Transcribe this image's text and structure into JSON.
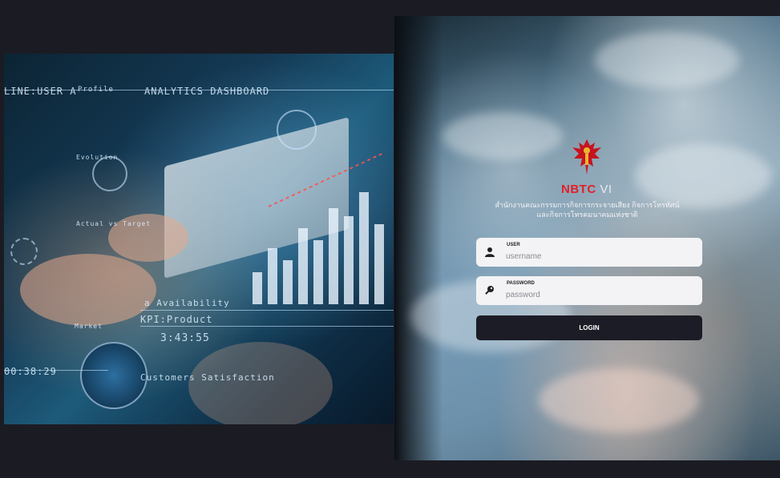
{
  "hero": {
    "texts": {
      "line_user": "LINE:USER A",
      "profile": "Profile",
      "dashboard": "ANALYTICS DASHBOARD",
      "evolution": "Evolution",
      "actual_vs_target": "Actual vs Target",
      "availability": "a Availability",
      "kpi": "KPI:Product",
      "time_small": "3:43:55",
      "market": "Market",
      "clock": "00:38:29",
      "customers": "Customers Satisfaction"
    },
    "bars": [
      40,
      70,
      55,
      95,
      80,
      120,
      110,
      140,
      100
    ]
  },
  "brand": {
    "part1": "NBTC",
    "part2": " VI"
  },
  "org_line1": "สำนักงานคณะกรรมการกิจการกระจายเสียง กิจการโทรทัศน์",
  "org_line2": "และกิจการโทรคมนาคมแห่งชาติ",
  "user_field": {
    "label": "USER",
    "placeholder": "username",
    "value": ""
  },
  "password_field": {
    "label": "PASSWORD",
    "placeholder": "password",
    "value": ""
  },
  "login_label": "LOGIN",
  "colors": {
    "background": "#1b1b23",
    "brand_red": "#e0202a",
    "button": "#1c1c26",
    "field_bg": "#f3f3f5"
  },
  "icons": {
    "user": "user-icon",
    "password": "key-icon",
    "emblem": "garuda-emblem"
  }
}
